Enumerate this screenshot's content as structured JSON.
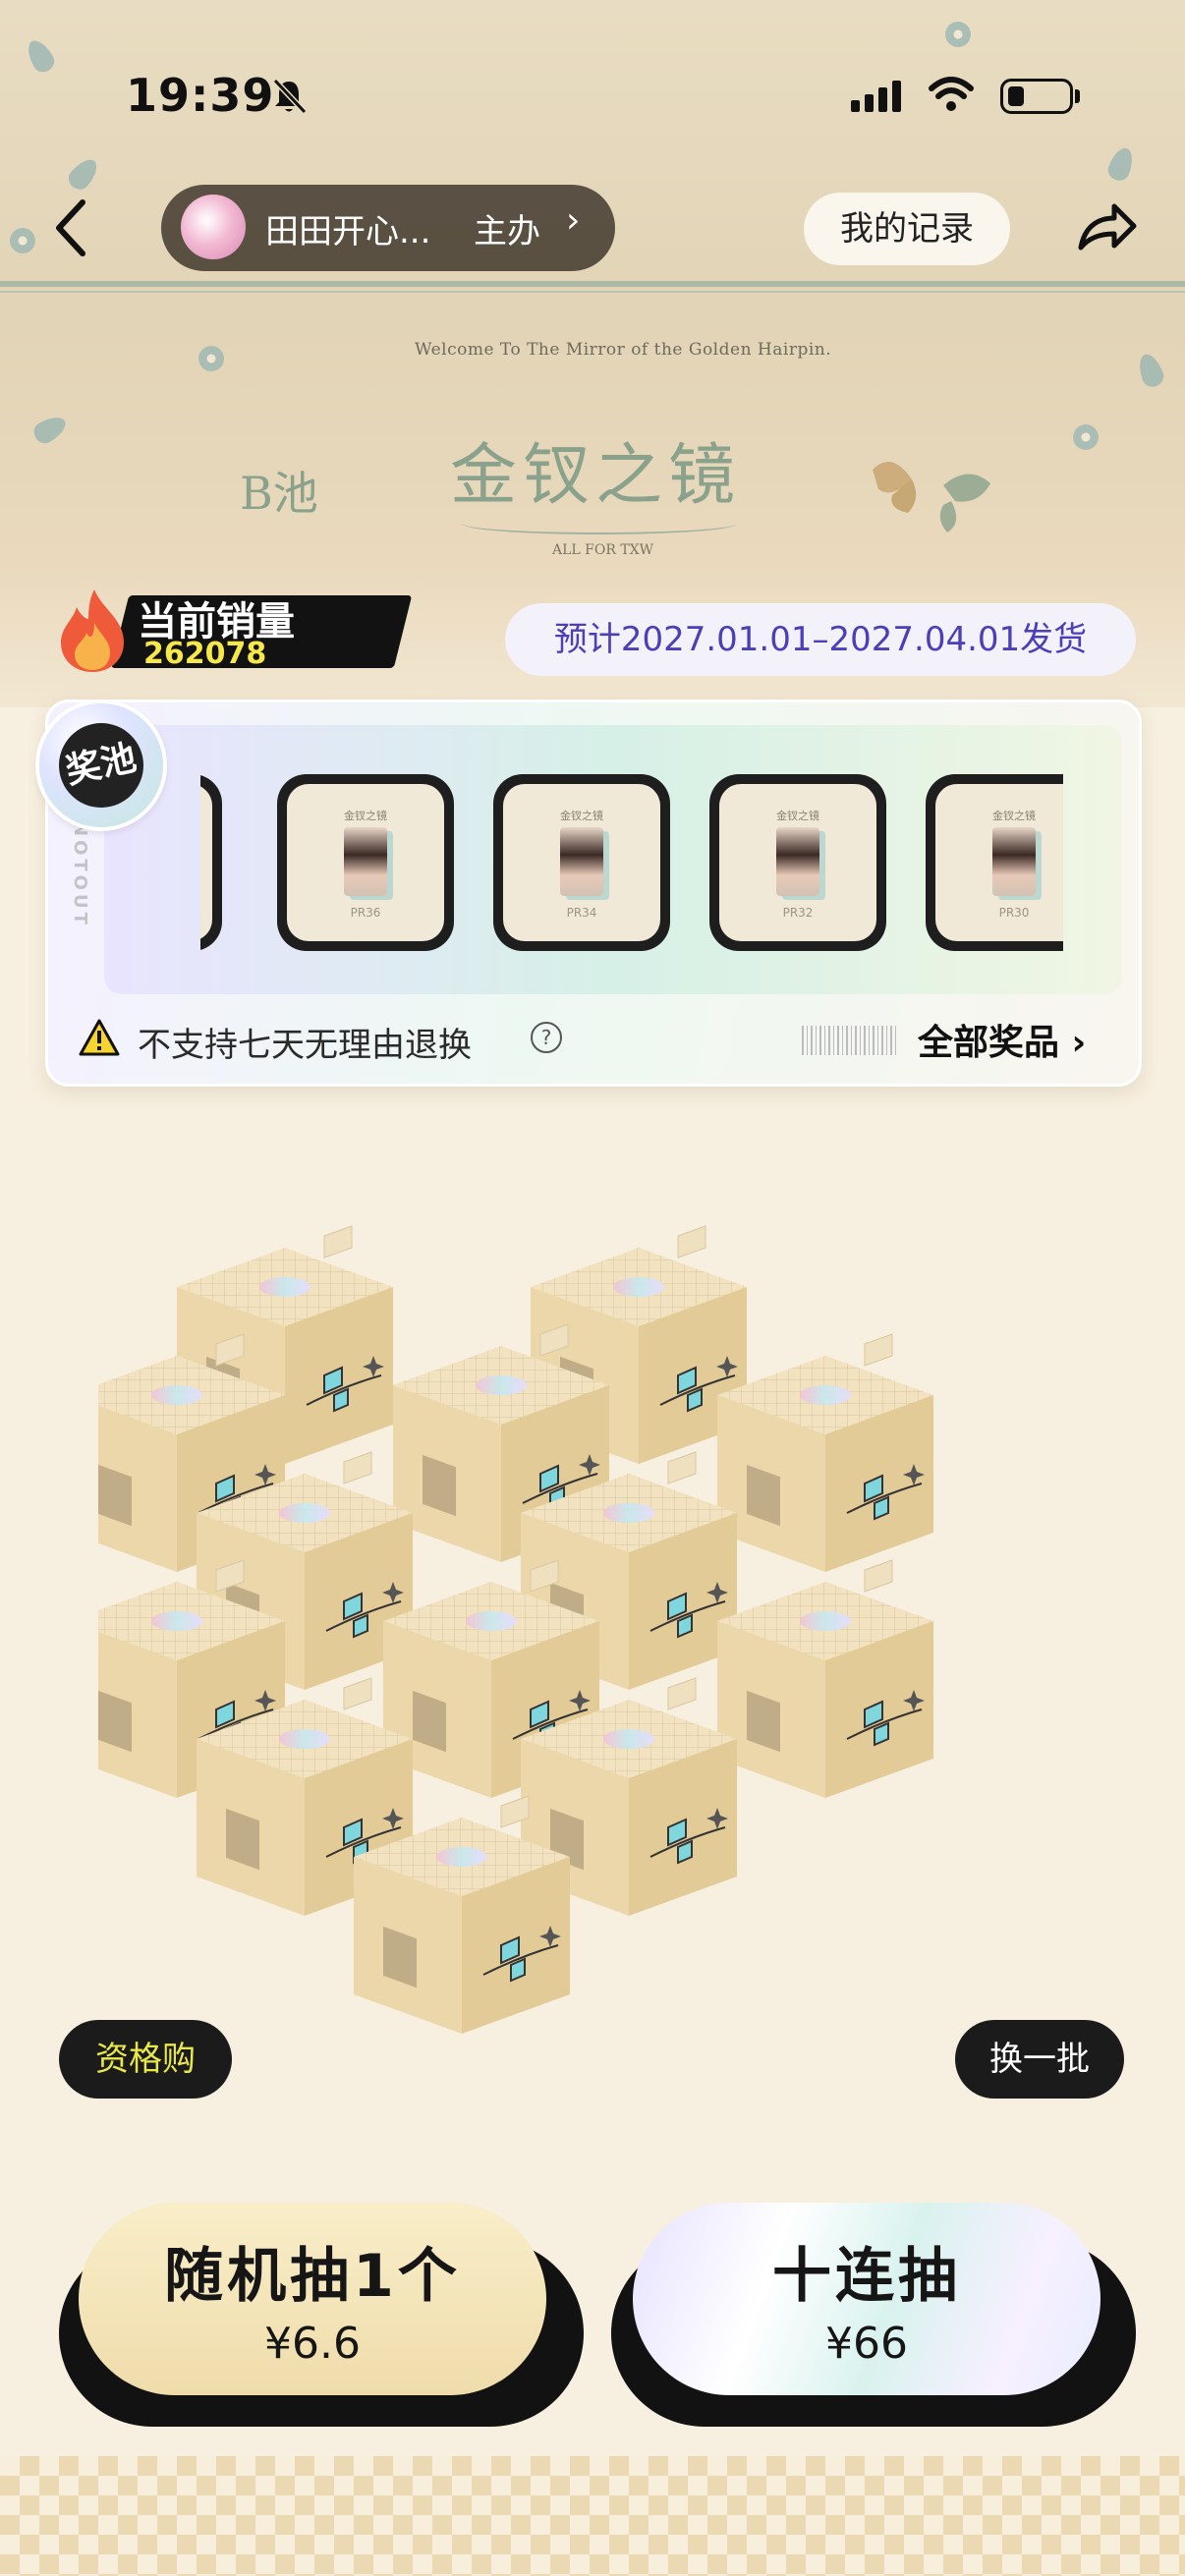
{
  "status_bar": {
    "time": "19:39"
  },
  "nav": {
    "organizer_name": "田田开心...",
    "organizer_role": "主办",
    "organizer_chevron": "›",
    "my_records": "我的记录"
  },
  "banner": {
    "welcome": "Welcome To The Mirror of the Golden Hairpin.",
    "pool": "B池",
    "title": "金钗之镜",
    "subtitle": "ALL FOR TXW"
  },
  "sales": {
    "label": "当前销量",
    "value": "262078"
  },
  "shipping": "预计2027.01.01–2027.04.01发货",
  "prize_pool": {
    "tag": "奖池",
    "side_text": "NOTOUT",
    "prizes": [
      {
        "header": "金钗之镜",
        "code": "PR36"
      },
      {
        "header": "金钗之镜",
        "code": "PR34"
      },
      {
        "header": "金钗之镜",
        "code": "PR32"
      },
      {
        "header": "金钗之镜",
        "code": "PR30"
      }
    ],
    "notice": "不支持七天无理由退换",
    "help": "?",
    "all_prizes": "全部奖品 ›"
  },
  "actions": {
    "qualification": "资格购",
    "refresh": "换一批"
  },
  "draws": {
    "single": {
      "title": "随机抽1个",
      "price": "¥6.6"
    },
    "ten": {
      "title": "十连抽",
      "price": "¥66"
    }
  },
  "colors": {
    "accent_green": "#8aa28c",
    "shipping_text": "#4a3fb8",
    "sales_value": "#f7e84a",
    "qual_text": "#e8e84a"
  },
  "icons": [
    "back-arrow-icon",
    "bell-muted-icon",
    "signal-icon",
    "wifi-icon",
    "battery-icon",
    "share-icon",
    "flame-icon",
    "warning-icon",
    "help-icon",
    "chevron-right-icon"
  ]
}
